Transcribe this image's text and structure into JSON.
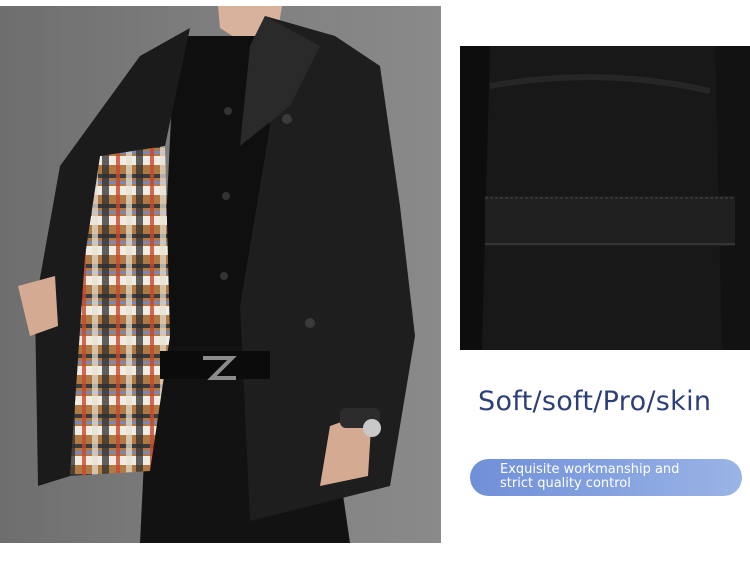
{
  "headline": "Soft/soft/Pro/skin",
  "badge": {
    "line1": "Exquisite workmanship and",
    "line2": "strict quality control",
    "color_start": "#6f8fd8",
    "color_end": "#9ab4e6"
  },
  "colors": {
    "headline": "#2e3f78",
    "coat": "#1a1a1a",
    "backdrop": "#7a7a7a"
  }
}
